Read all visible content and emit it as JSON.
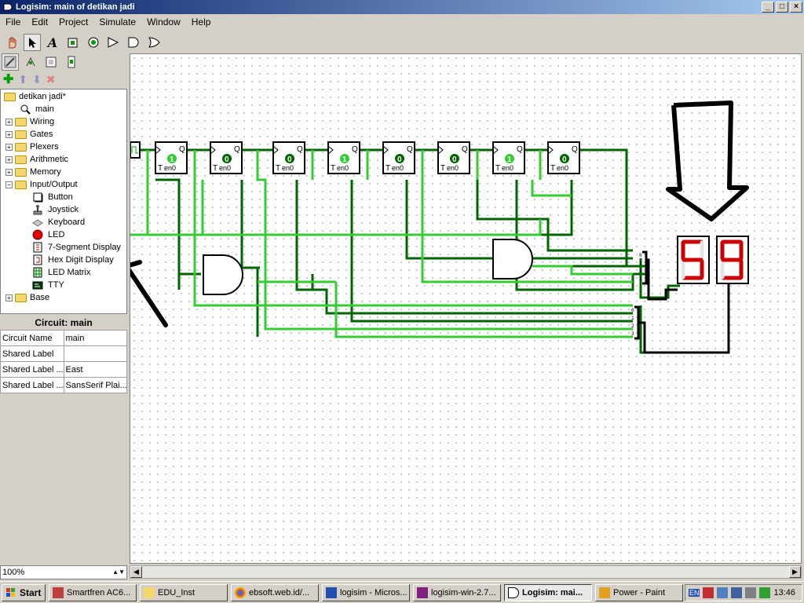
{
  "window": {
    "title": "Logisim: main of detikan jadi"
  },
  "menu": [
    "File",
    "Edit",
    "Project",
    "Simulate",
    "Window",
    "Help"
  ],
  "tree": {
    "project": "detikan jadi*",
    "circuit": "main",
    "libraries": [
      {
        "label": "Wiring"
      },
      {
        "label": "Gates"
      },
      {
        "label": "Plexers"
      },
      {
        "label": "Arithmetic"
      },
      {
        "label": "Memory"
      },
      {
        "label": "Input/Output",
        "expanded": true
      },
      {
        "label": "Base"
      }
    ],
    "io_items": [
      {
        "label": "Button",
        "icon": "button-icon"
      },
      {
        "label": "Joystick",
        "icon": "joystick-icon"
      },
      {
        "label": "Keyboard",
        "icon": "keyboard-icon"
      },
      {
        "label": "LED",
        "icon": "led-icon"
      },
      {
        "label": "7-Segment Display",
        "icon": "seven-segment-icon"
      },
      {
        "label": "Hex Digit Display",
        "icon": "hex-digit-icon"
      },
      {
        "label": "LED Matrix",
        "icon": "led-matrix-icon"
      },
      {
        "label": "TTY",
        "icon": "tty-icon"
      }
    ]
  },
  "properties": {
    "title": "Circuit: main",
    "rows": [
      {
        "key": "Circuit Name",
        "value": "main"
      },
      {
        "key": "Shared Label",
        "value": ""
      },
      {
        "key": "Shared Label ...",
        "value": "East"
      },
      {
        "key": "Shared Label ...",
        "value": "SansSerif Plai..."
      }
    ]
  },
  "zoom": "100%",
  "circuit": {
    "flipflop_values": [
      "1",
      "0",
      "0",
      "1",
      "0",
      "0",
      "1",
      "0"
    ],
    "flipflop_label": "T",
    "flipflop_sublabel": "en0",
    "flipflop_q": "Q",
    "splitter_labels": [
      "0",
      "1",
      "2",
      "3"
    ],
    "display_digits": [
      "5",
      "9"
    ]
  },
  "colors": {
    "wire_on": "#33cc33",
    "wire_off": "#006400",
    "segment": "#cc0000"
  },
  "taskbar": {
    "start": "Start",
    "items": [
      {
        "label": "Smartfren AC6...",
        "icon": "modem-icon"
      },
      {
        "label": "EDU_Inst",
        "icon": "folder-icon"
      },
      {
        "label": "ebsoft.web.id/...",
        "icon": "chrome-icon"
      },
      {
        "label": "logisim - Micros...",
        "icon": "word-icon"
      },
      {
        "label": "logisim-win-2.7...",
        "icon": "winrar-icon"
      },
      {
        "label": "Logisim: mai...",
        "icon": "logisim-icon",
        "active": true
      },
      {
        "label": "Power - Paint",
        "icon": "paint-icon"
      }
    ],
    "lang": "EN",
    "clock": "13:46"
  }
}
